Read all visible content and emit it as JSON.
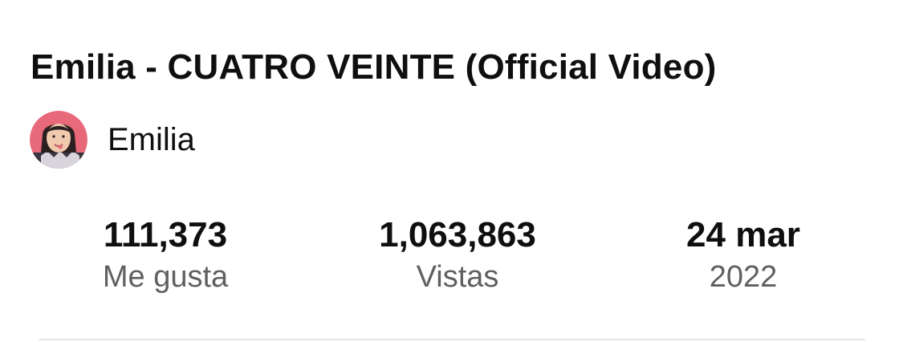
{
  "video": {
    "title": "Emilia - CUATRO VEINTE (Official Video)"
  },
  "channel": {
    "name": "Emilia",
    "avatar_icon": "channel-avatar"
  },
  "stats": {
    "likes": {
      "value": "111,373",
      "label": "Me gusta"
    },
    "views": {
      "value": "1,063,863",
      "label": "Vistas"
    },
    "date": {
      "value": "24 mar",
      "label": "2022"
    }
  },
  "colors": {
    "text_primary": "#0f0f0f",
    "text_secondary": "#606060",
    "divider": "#e5e5e5",
    "avatar_background": "#e86a7a"
  }
}
